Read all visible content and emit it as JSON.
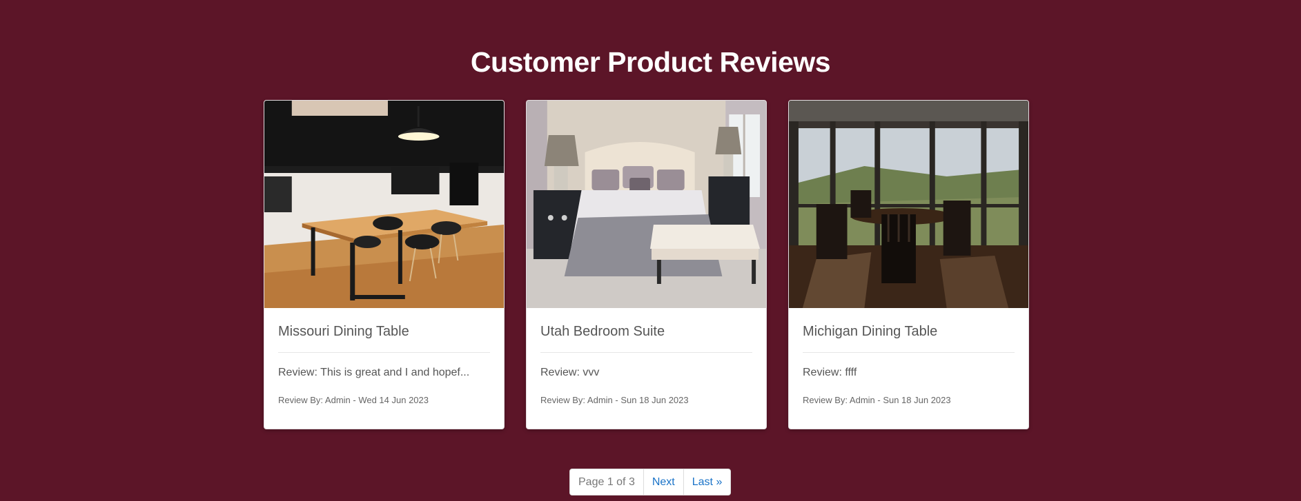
{
  "page": {
    "title": "Customer Product Reviews",
    "background_color": "#5c1528"
  },
  "reviews": [
    {
      "product": "Missouri Dining Table",
      "review": "Review: This is great and I and hopef...",
      "meta": "Review By: Admin - Wed 14 Jun 2023",
      "image": "office-dining-table-photo"
    },
    {
      "product": "Utah Bedroom Suite",
      "review": "Review: vvv",
      "meta": "Review By: Admin - Sun 18 Jun 2023",
      "image": "bedroom-suite-photo"
    },
    {
      "product": "Michigan Dining Table",
      "review": "Review: ffff",
      "meta": "Review By: Admin - Sun 18 Jun 2023",
      "image": "sunroom-dining-table-photo"
    }
  ],
  "pagination": {
    "page_info": "Page 1 of 3",
    "next_label": "Next",
    "last_label": "Last »",
    "link_color": "#1a73c8"
  }
}
